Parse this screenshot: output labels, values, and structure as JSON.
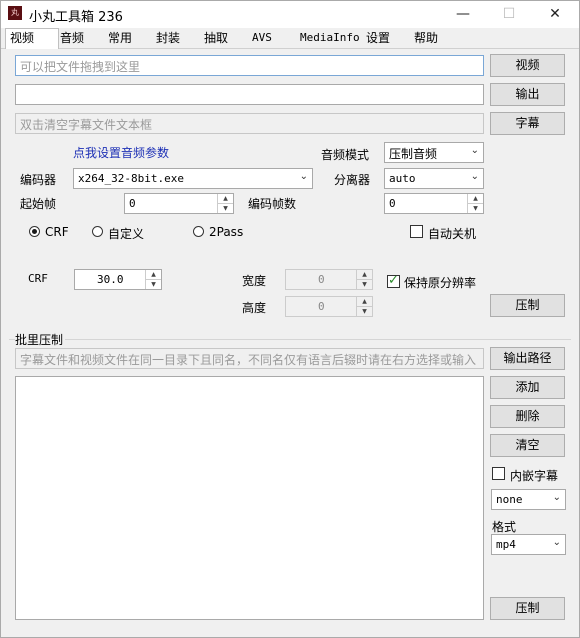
{
  "window": {
    "title": "小丸工具箱 236",
    "icon_text": "丸"
  },
  "tabs": [
    {
      "label": "视频"
    },
    {
      "label": "音频"
    },
    {
      "label": "常用"
    },
    {
      "label": "封装"
    },
    {
      "label": "抽取"
    },
    {
      "label": "AVS"
    },
    {
      "label": "MediaInfo"
    },
    {
      "label": "设置"
    },
    {
      "label": "帮助"
    }
  ],
  "inputs": {
    "video_placeholder": "可以把文件拖拽到这里",
    "subtitle_placeholder": "双击清空字幕文件文本框"
  },
  "buttons": {
    "video": "视频",
    "output": "输出",
    "subtitle": "字幕",
    "compress": "压制",
    "output_path": "输出路径",
    "add": "添加",
    "delete": "删除",
    "clear": "清空",
    "batch_compress": "压制"
  },
  "audio": {
    "settings_link": "点我设置音频参数",
    "mode_label": "音频模式",
    "mode_value": "压制音频"
  },
  "encoder": {
    "label": "编码器",
    "value": "x264_32-8bit.exe"
  },
  "demuxer": {
    "label": "分离器",
    "value": "auto"
  },
  "start_frame": {
    "label": "起始帧",
    "value": "0"
  },
  "frame_count": {
    "label": "编码帧数",
    "value": "0"
  },
  "rate_mode": {
    "crf": "CRF",
    "custom": "自定义",
    "twopass": "2Pass",
    "selected": "CRF"
  },
  "auto_shutdown": {
    "label": "自动关机",
    "checked": false
  },
  "crf": {
    "label": "CRF",
    "value": "30.0"
  },
  "width": {
    "label": "宽度",
    "value": "0"
  },
  "height": {
    "label": "高度",
    "value": "0"
  },
  "keep_resolution": {
    "label": "保持原分辨率",
    "checked": true
  },
  "batch": {
    "title": "批里压制",
    "hint": "字幕文件和视频文件在同一目录下且同名，不同名仅有语言后辍时请在右方选择或输入",
    "embed_sub": {
      "label": "内嵌字幕",
      "checked": false
    },
    "sub_lang_value": "none",
    "format_label": "格式",
    "format_value": "mp4"
  },
  "icons": {
    "minimize": "minimize-icon",
    "maximize": "maximize-icon",
    "close": "close-icon",
    "dropdown": "chevron-down-icon"
  }
}
